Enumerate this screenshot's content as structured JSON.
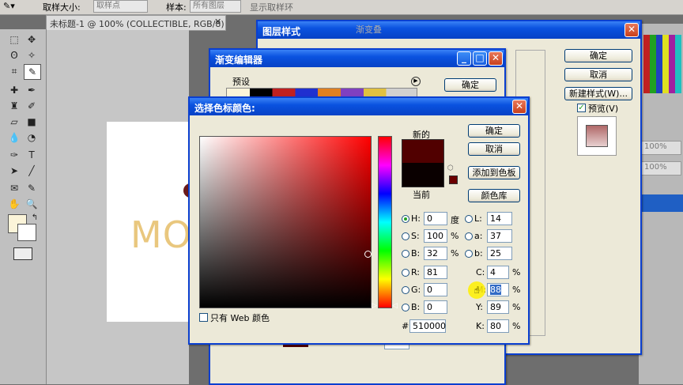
{
  "options_bar": {
    "sample_size_label": "取样大小:",
    "sample_size_value": "取样点",
    "sample_label": "样本:",
    "sample_value": "所有图层",
    "show_ring_label": "显示取样环"
  },
  "document": {
    "tab_title": "未标题-1 @ 100% (COLLECTIBLE, RGB/8) *",
    "canvas_text": "MO"
  },
  "layer_style": {
    "title": "图层样式",
    "partial_text": "渐变叠",
    "ok": "确定",
    "cancel": "取消",
    "new_style": "新建样式(W)...",
    "preview": "预览(V)"
  },
  "gradient_editor": {
    "title": "渐变编辑器",
    "presets_label": "预设",
    "ok": "确定"
  },
  "color_picker": {
    "title": "选择色标颜色:",
    "new_label": "新的",
    "current_label": "当前",
    "ok": "确定",
    "cancel": "取消",
    "add_to_swatches": "添加到色板",
    "color_libraries": "颜色库",
    "web_only": "只有 Web 颜色",
    "fields": {
      "H": "0",
      "H_unit": "度",
      "S": "100",
      "S_unit": "%",
      "B": "32",
      "B_unit": "%",
      "R": "81",
      "G": "0",
      "Bv": "0",
      "L": "14",
      "a": "37",
      "b": "25",
      "C": "4",
      "M": "88",
      "Y": "89",
      "K": "80",
      "hex": "510000",
      "pct": "%"
    },
    "labels": {
      "H": "H:",
      "S": "S:",
      "B": "B:",
      "R": "R:",
      "G": "G:",
      "Bb": "B:",
      "L": "L:",
      "a": "a:",
      "b": "b:",
      "C": "C:",
      "M": "M:",
      "Y": "Y:",
      "K": "K:",
      "hash": "#"
    },
    "colors": {
      "new": "#510000",
      "current": "#0a0000",
      "hue": "#ff0000"
    }
  }
}
